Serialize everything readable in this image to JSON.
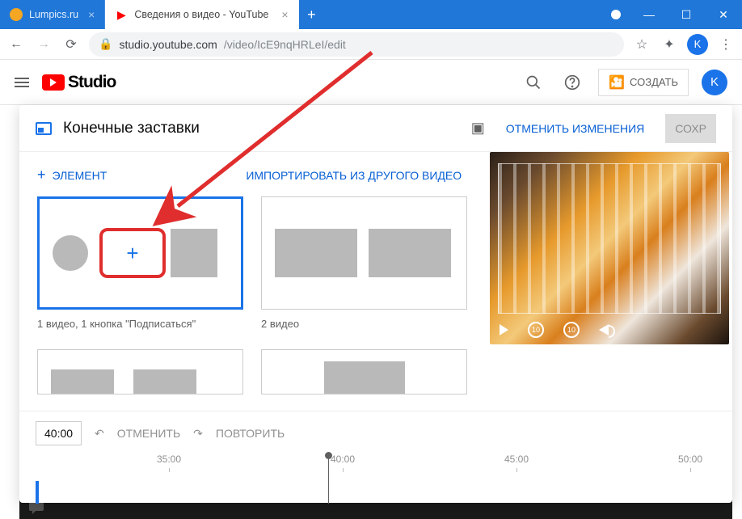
{
  "browser": {
    "tabs": [
      {
        "title": "Lumpics.ru"
      },
      {
        "title": "Сведения о видео - YouTube Stu"
      }
    ],
    "url_host": "studio.youtube.com",
    "url_path": "/video/IcE9nqHRLeI/edit"
  },
  "studio_header": {
    "logo": "Studio",
    "create": "СОЗДАТЬ",
    "avatar_letter": "K"
  },
  "panel": {
    "title": "Конечные заставки",
    "cancel": "ОТМЕНИТЬ ИЗМЕНЕНИЯ",
    "save": "СОХР",
    "element_btn": "ЭЛЕМЕНТ",
    "import_btn": "ИМПОРТИРОВАТЬ ИЗ ДРУГОГО ВИДЕО",
    "templates": [
      {
        "label": "1 видео, 1 кнопка \"Подписаться\""
      },
      {
        "label": "2 видео"
      }
    ]
  },
  "timeline": {
    "time": "40:00",
    "undo": "ОТМЕНИТЬ",
    "redo": "ПОВТОРИТЬ",
    "ticks": [
      "35:00",
      "40:00",
      "45:00",
      "50:00"
    ]
  },
  "urlbar_avatar": "K",
  "rewind": "10",
  "forward": "10"
}
